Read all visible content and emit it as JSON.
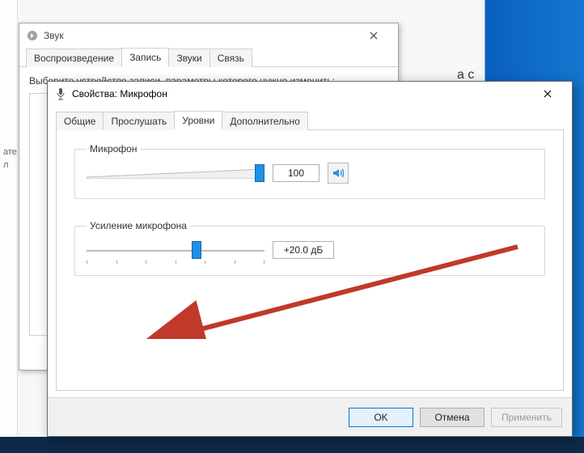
{
  "sound_window": {
    "title": "Звук",
    "tabs": [
      "Воспроизведение",
      "Запись",
      "Звуки",
      "Связь"
    ],
    "active_tab_index": 1,
    "instruction": "Выберите устройство записи, параметры которого нужно изменить:"
  },
  "props_window": {
    "title": "Свойства: Микрофон",
    "tabs": [
      "Общие",
      "Прослушать",
      "Уровни",
      "Дополнительно"
    ],
    "active_tab_index": 2,
    "sliders": {
      "mic": {
        "label": "Микрофон",
        "value_text": "100",
        "value_pct": 100
      },
      "boost": {
        "label": "Усиление микрофона",
        "value_text": "+20.0 дБ",
        "value_pct": 62
      }
    },
    "buttons": {
      "ok": "OK",
      "cancel": "Отмена",
      "apply": "Применить"
    }
  },
  "backdrop_hints": {
    "partial1": "ате",
    "partial2": "л",
    "right_fragment": "а с"
  },
  "colors": {
    "accent": "#0078d7",
    "slider_thumb": "#1e90e8",
    "arrow": "#c0392b"
  }
}
